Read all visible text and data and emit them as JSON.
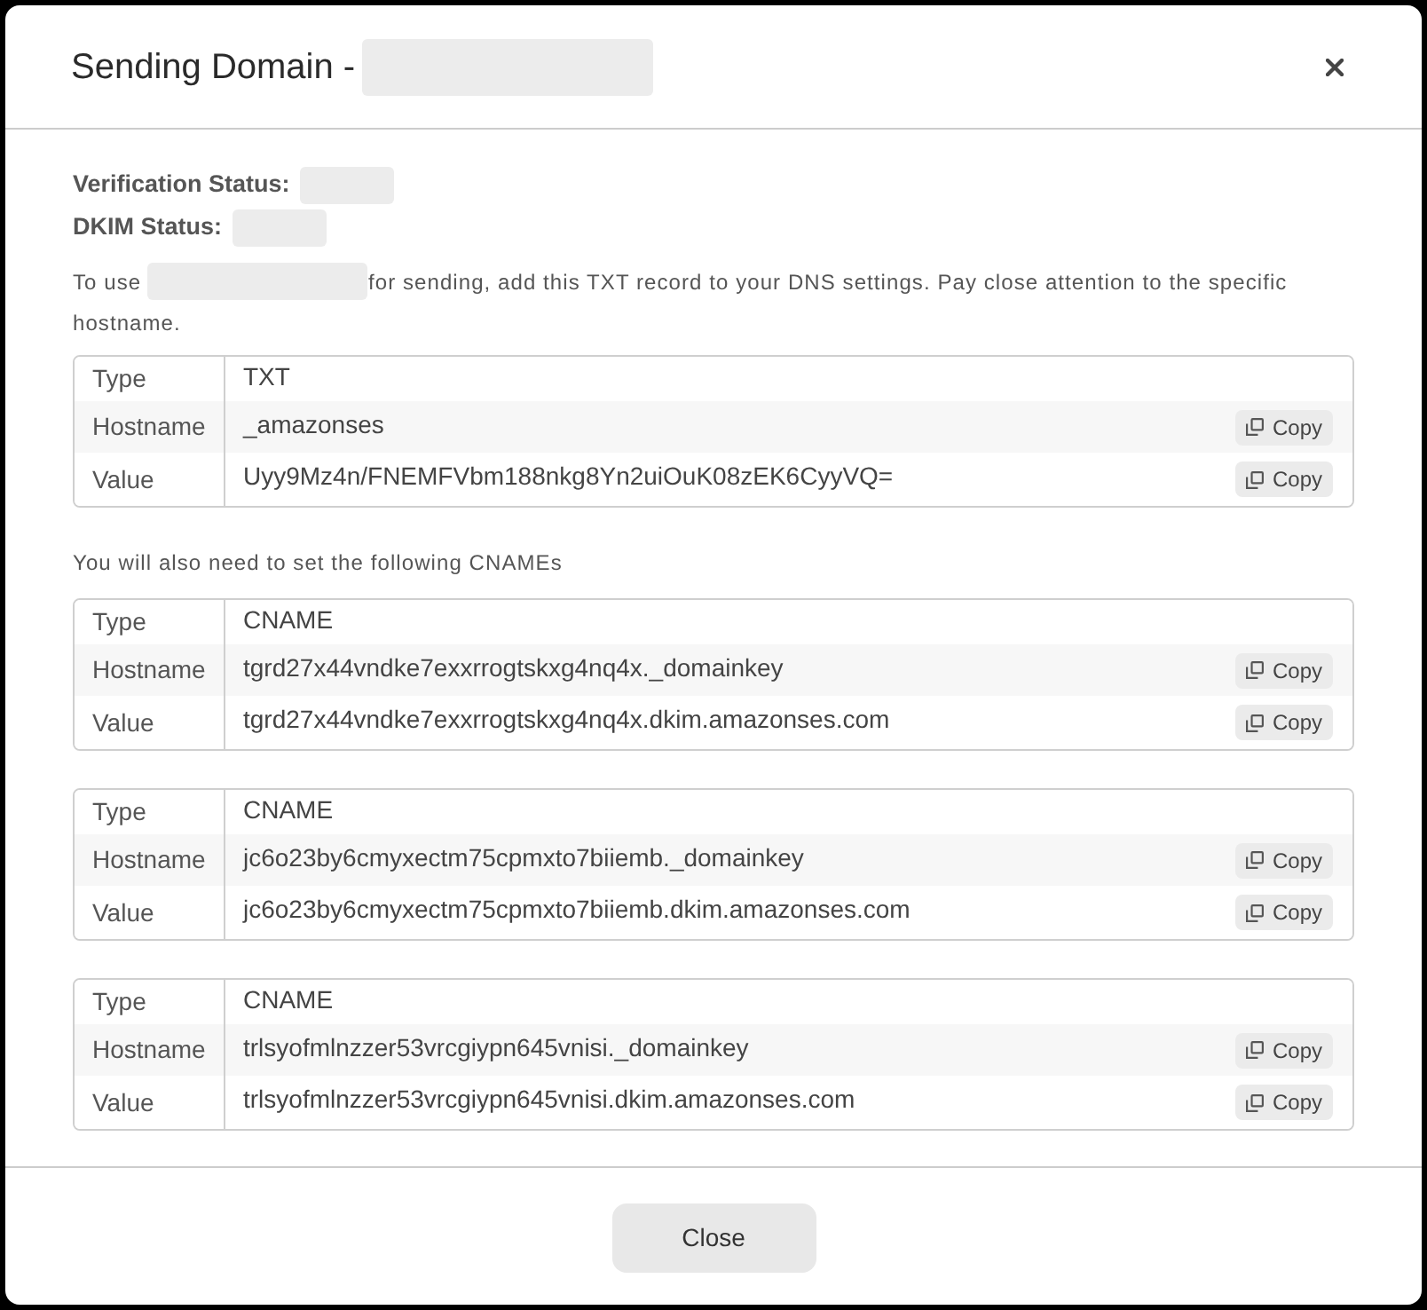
{
  "dialog": {
    "title": {
      "text": "Sending Domain -",
      "redacted": true
    }
  },
  "statuses": [
    {
      "label": "Verification Status:",
      "redacted": true
    },
    {
      "label": "DKIM Status:",
      "redacted": true
    }
  ],
  "instruction": {
    "before": "To use",
    "redacted": true,
    "after": "for sending, add this TXT record to your DNS settings. Pay close attention to the specific hostname."
  },
  "txt_record": {
    "rows": [
      {
        "label": "Type",
        "value": "TXT"
      },
      {
        "label": "Hostname",
        "value": "_amazonses",
        "copy_button": "Copy"
      },
      {
        "label": "Value",
        "value": "Uyy9Mz4n/FNEMFVbm188nkg8Yn2uiOuK08zEK6CyyVQ=",
        "copy_button": "Copy"
      }
    ]
  },
  "cname_note": "You will also need to set the following CNAMEs",
  "cname_records": [
    {
      "rows": [
        {
          "label": "Type",
          "value": "CNAME"
        },
        {
          "label": "Hostname",
          "value": "tgrd27x44vndke7exxrrogtskxg4nq4x._domainkey",
          "copy_button": "Copy"
        },
        {
          "label": "Value",
          "value": "tgrd27x44vndke7exxrrogtskxg4nq4x.dkim.amazonses.com",
          "copy_button": "Copy"
        }
      ]
    },
    {
      "rows": [
        {
          "label": "Type",
          "value": "CNAME"
        },
        {
          "label": "Hostname",
          "value": "jc6o23by6cmyxectm75cpmxto7biiemb._domainkey",
          "copy_button": "Copy"
        },
        {
          "label": "Value",
          "value": "jc6o23by6cmyxectm75cpmxto7biiemb.dkim.amazonses.com",
          "copy_button": "Copy"
        }
      ]
    },
    {
      "rows": [
        {
          "label": "Type",
          "value": "CNAME"
        },
        {
          "label": "Hostname",
          "value": "trlsyofmlnzzer53vrcgiypn645vnisi._domainkey",
          "copy_button": "Copy"
        },
        {
          "label": "Value",
          "value": "trlsyofmlnzzer53vrcgiypn645vnisi.dkim.amazonses.com",
          "copy_button": "Copy"
        }
      ]
    }
  ],
  "footer": {
    "close_button": "Close"
  }
}
